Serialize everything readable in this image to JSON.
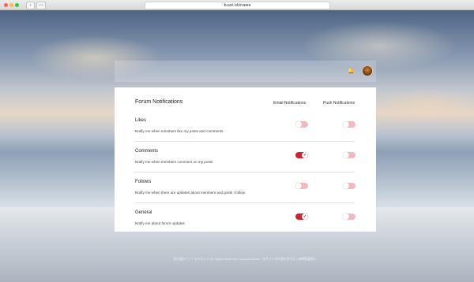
{
  "browser": {
    "address": "buzz.okinawa",
    "back_glyph": "‹",
    "sidebar_glyph": "▭"
  },
  "header": {
    "bell_icon": "🔔"
  },
  "card": {
    "title": "Forum Notifications",
    "columns": {
      "email": "Email Notifications",
      "push": "Push Notifications"
    },
    "rows": [
      {
        "title": "Likes",
        "description": "Notify me when members like my posts and comments.",
        "email_on": false,
        "push_on": false
      },
      {
        "title": "Comments",
        "description": "Notify me when members comment on my posts",
        "email_on": true,
        "push_on": false
      },
      {
        "title": "Follows",
        "description": "Notify me when there are updates about members and posts I follow.",
        "email_on": false,
        "push_on": false
      },
      {
        "title": "General",
        "description": "Notify me about forum updates",
        "email_on": true,
        "push_on": false
      }
    ],
    "check_glyph": "✓"
  },
  "footer": {
    "text": "宮古島のソーシャルネット All rights reserved. buzz.okinawa · 本サイトの内容を許可なく無断転載禁止"
  },
  "colors": {
    "toggle_on": "#d3212e",
    "toggle_off": "#f5b9bd",
    "card_bg": "#ffffff"
  }
}
